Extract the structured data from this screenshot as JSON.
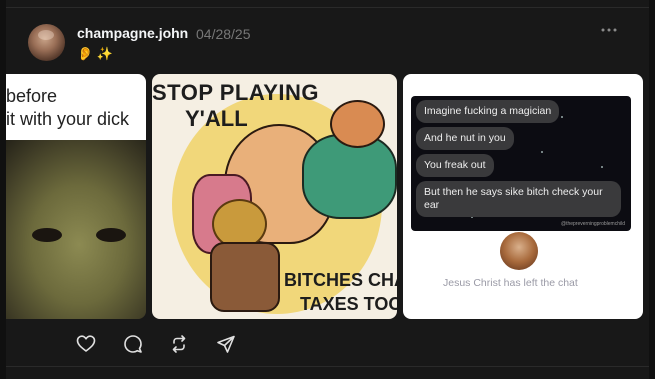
{
  "post": {
    "username": "champagne.john",
    "date": "04/28/25",
    "status_emojis": "👂 ✨"
  },
  "media": [
    {
      "caption_lines": [
        "before",
        "it with your dick"
      ]
    },
    {
      "top_lines": [
        "STOP PLAYING",
        "Y'ALL"
      ],
      "bottom_lines": [
        "BITCHES CHASE",
        "TAXES TOO..."
      ]
    },
    {
      "messages": [
        "Imagine fucking a magician",
        "And he nut in you",
        "You freak out",
        "But then he says sike bitch check your ear"
      ],
      "watermark": "@thepreverningproblemchild",
      "footer": "Jesus Christ has left the chat"
    }
  ],
  "actions": [
    "heart-icon",
    "comment-icon",
    "repost-icon",
    "share-icon"
  ],
  "colors": {
    "background": "#181818",
    "text": "#f3f5f7",
    "muted": "#777777"
  }
}
